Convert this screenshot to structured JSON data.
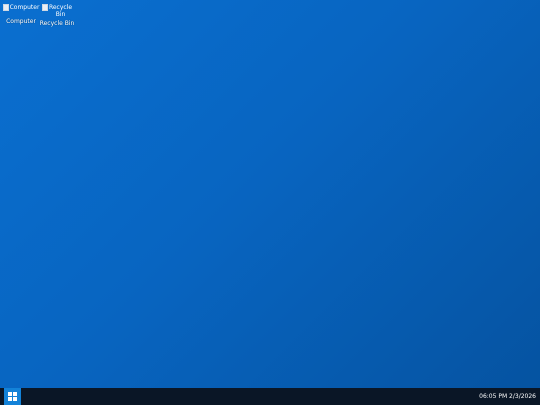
{
  "desktop": {
    "background_color": "#0865c1",
    "icons": [
      {
        "name": "computer",
        "alt": "Computer",
        "label": "Computer",
        "icon": "computer-icon"
      },
      {
        "name": "recycle-bin",
        "alt_line1": "Recycle",
        "alt_line2": "Bin",
        "label": "Recycle Bin",
        "icon": "recycle-bin-icon"
      }
    ]
  },
  "taskbar": {
    "background_color": "#0a1626",
    "start_icon": "windows-logo-icon",
    "start_color": "#1382d8",
    "clock": "06:05 PM 2/3/2026"
  }
}
